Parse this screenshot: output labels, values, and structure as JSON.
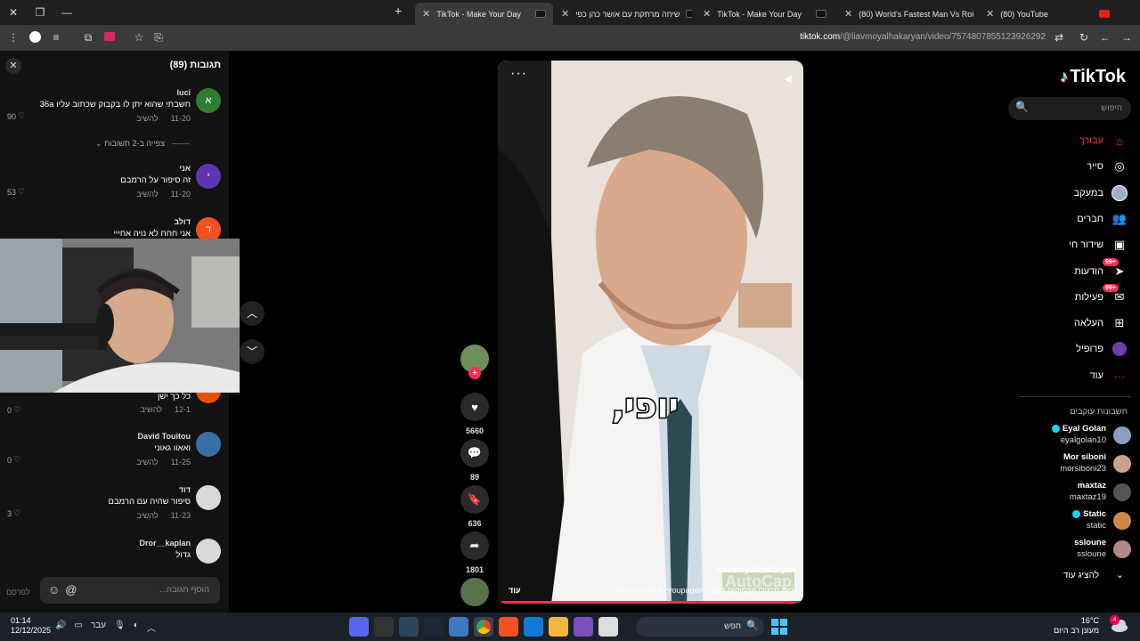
{
  "browser": {
    "tabs": [
      {
        "title": "TikTok - Make Your Day",
        "icon": "tiktok-icon",
        "active": true
      },
      {
        "title": "שיחה מרתקת עם אושר כהן כפי",
        "icon": "tiktok-icon",
        "active": false
      },
      {
        "title": "TikTok - Make Your Day",
        "icon": "tiktok-icon",
        "active": false
      },
      {
        "title": "(80) World's Fastest Man Vs Roi",
        "icon": "youtube-icon",
        "active": false
      },
      {
        "title": "(80) YouTube",
        "icon": "youtube-icon",
        "active": false
      }
    ],
    "url_domain": "tiktok.com",
    "url_path": "/@liavmoyalhakaryan/video/7574807855123926292"
  },
  "comments": {
    "title": "תגובות (89)",
    "reply_label": "להשיב",
    "view_replies": "צפייה ב-2 תשובות",
    "items": [
      {
        "user": "luci",
        "text": "חשבתי שהוא יתן לו בקבוק שכתוב עליו 36a",
        "date": "11-20",
        "likes": "90",
        "avatar_letter": "א",
        "avatar_color": "#2e7d32"
      },
      {
        "user": "אני",
        "text": "זה סיפור על הרמבם",
        "date": "11-20",
        "likes": "53",
        "avatar_letter": "י",
        "avatar_color": "#5e35b1"
      },
      {
        "user": "דולב",
        "text": "אני חחח לא נויה אחייי",
        "date": "",
        "likes": "",
        "avatar_letter": "ד",
        "avatar_color": "#f4511e"
      },
      {
        "user": "",
        "text": "כל כך ישן",
        "date": "12-1",
        "likes": "0",
        "avatar_letter": "",
        "avatar_color": "#e65100"
      },
      {
        "user": "David Touitou",
        "text": "ואאוו גאוני",
        "date": "11-25",
        "likes": "0",
        "avatar_letter": "",
        "avatar_color": "#3b6ea5"
      },
      {
        "user": "דוד",
        "text": "סיפור שהיה עם הרמבם",
        "date": "11-23",
        "likes": "3",
        "avatar_letter": "",
        "avatar_color": "#d9d9d9"
      },
      {
        "user": "Dror__kaplan",
        "text": "גדול",
        "date": "",
        "likes": "",
        "avatar_letter": "",
        "avatar_color": "#d9d9d9"
      }
    ],
    "input_placeholder": "הוסף תגובה...",
    "post_label": "לפרסם"
  },
  "actions": {
    "likes": "5660",
    "comments": "89",
    "saves": "636",
    "shares": "1801"
  },
  "video": {
    "caption": "יופי,",
    "username": "liavmoyalhakaryan",
    "description": "איזה תרגיל! #צחוקים #פוריו #foryoupage #פוריוישראל ...",
    "more_label": "עוד",
    "watermark": "AutoCap",
    "progress": 0.97
  },
  "sidebar": {
    "logo": "TikTok",
    "search_placeholder": "חיפוש",
    "nav": [
      {
        "label": "עבורך",
        "icon": "home-icon",
        "active": true,
        "badge": ""
      },
      {
        "label": "סייר",
        "icon": "compass-icon",
        "active": false,
        "badge": ""
      },
      {
        "label": "במעקב",
        "icon": "following-avatar-icon",
        "active": false,
        "badge": ""
      },
      {
        "label": "חברים",
        "icon": "friends-icon",
        "active": false,
        "badge": ""
      },
      {
        "label": "שידור חי",
        "icon": "live-icon",
        "active": false,
        "badge": ""
      },
      {
        "label": "הודעות",
        "icon": "send-icon",
        "active": false,
        "badge": "99+"
      },
      {
        "label": "פעילות",
        "icon": "inbox-icon",
        "active": false,
        "badge": "99+"
      },
      {
        "label": "העלאה",
        "icon": "upload-icon",
        "active": false,
        "badge": ""
      },
      {
        "label": "פרופיל",
        "icon": "profile-avatar-icon",
        "active": false,
        "badge": ""
      },
      {
        "label": "עוד",
        "icon": "more-dots-icon",
        "active": false,
        "badge": ""
      }
    ],
    "following_title": "חשבונות עוקבים",
    "accounts": [
      {
        "name": "Eyal Golan",
        "handle": "eyalgolan10",
        "verified": true,
        "color": "#8aa0c0"
      },
      {
        "name": "Mor siboni",
        "handle": "morsiboni23",
        "verified": false,
        "color": "#c9a28a"
      },
      {
        "name": "maxtaz",
        "handle": "maxtaz19",
        "verified": false,
        "color": "#555555"
      },
      {
        "name": "Static",
        "handle": "static",
        "verified": true,
        "color": "#d0884a"
      },
      {
        "name": "ssloune",
        "handle": "ssloune",
        "verified": false,
        "color": "#b08a8a"
      }
    ],
    "show_more": "להציג עוד"
  },
  "taskbar": {
    "time": "01:14",
    "date": "12/12/2025",
    "lang": "עבר",
    "search_label": "חפש",
    "weather_temp": "16°C",
    "weather_desc": "מעונן רב היום",
    "notifications": "4"
  }
}
